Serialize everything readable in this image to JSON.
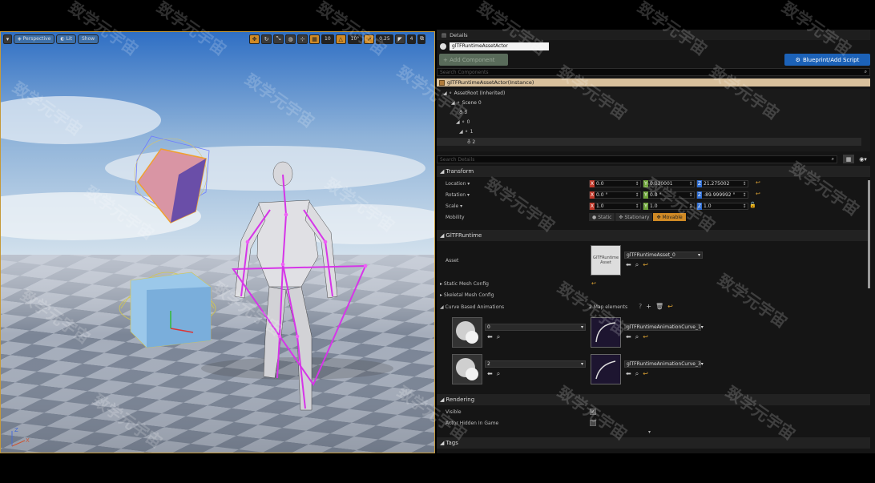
{
  "viewport": {
    "toolbar": {
      "menu_icon": "chevron-down-icon",
      "perspective_label": "Perspective",
      "lit_label": "Lit",
      "show_label": "Show",
      "grid_snap_value": "10",
      "rotation_snap_value": "10°",
      "scale_snap_value": "0.25",
      "camera_speed_value": "4"
    },
    "axis_labels": {
      "z": "Z",
      "x": "X"
    }
  },
  "details": {
    "tab_title": "Details",
    "actor_name": "glTFRuntimeAssetActor",
    "add_component_label": "+ Add Component",
    "blueprint_label": "Blueprint/Add Script",
    "search_components_placeholder": "Search Components",
    "instance_label": "glTFRuntimeAssetActor(Instance)",
    "tree": [
      {
        "label": "AssetRoot (Inherited)"
      },
      {
        "label": "Scene 0"
      },
      {
        "label": "3"
      },
      {
        "label": "0"
      },
      {
        "label": "1"
      },
      {
        "label": "2"
      }
    ],
    "search_details_placeholder": "Search Details",
    "transform": {
      "header": "Transform",
      "location_label": "Location",
      "rotation_label": "Rotation",
      "scale_label": "Scale",
      "mobility_label": "Mobility",
      "location": [
        "0.0",
        "0.030001",
        "21.275002"
      ],
      "rotation": [
        "0.0 °",
        "0.0 °",
        "-89.999992 °"
      ],
      "scale": [
        "1.0",
        "1.0",
        "1.0"
      ],
      "mobility_options": [
        "Static",
        "Stationary",
        "Movable"
      ],
      "mobility_selected": "Movable"
    },
    "gltf": {
      "header": "GlTFRuntime",
      "asset_label": "Asset",
      "asset_thumb_text": "GlTFRuntime Asset",
      "asset_value": "glTFRuntimeAsset_0",
      "static_mesh_config": "Static Mesh Config",
      "skeletal_mesh_config": "Skeletal Mesh Config",
      "curve_label": "Curve Based Animations",
      "map_elements": "2 Map elements",
      "entries": [
        {
          "key": "0",
          "value": "glTFRuntimeAnimationCurve_1"
        },
        {
          "key": "2",
          "value": "glTFRuntimeAnimationCurve_3"
        }
      ]
    },
    "rendering": {
      "header": "Rendering",
      "visible_label": "Visible",
      "hidden_label": "Actor Hidden In Game"
    },
    "tags": {
      "header": "Tags"
    }
  },
  "watermark": "致学元宇宙"
}
